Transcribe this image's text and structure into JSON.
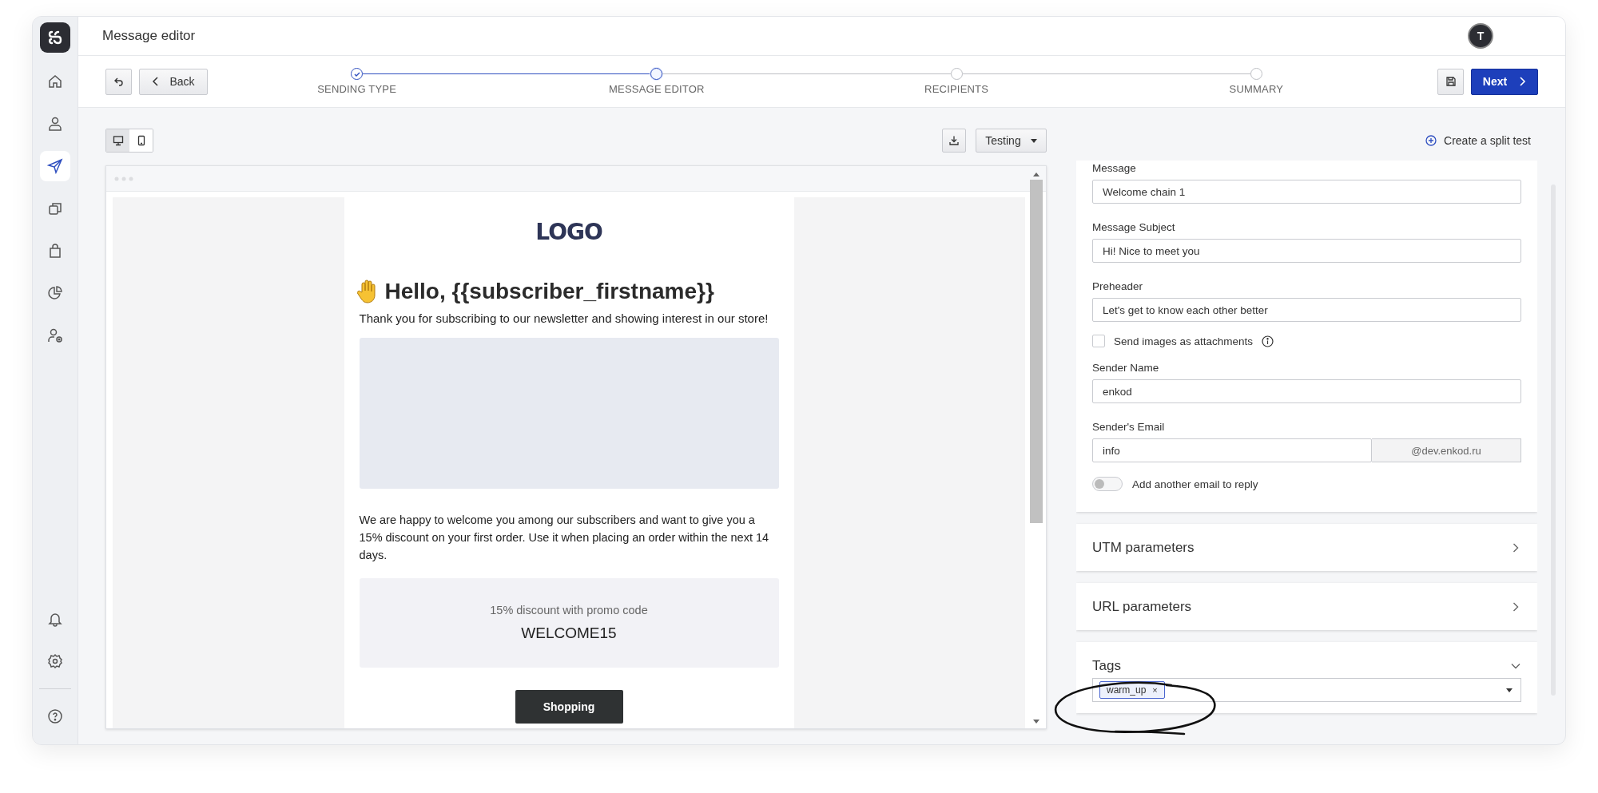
{
  "app_title": "Message editor",
  "user": {
    "initial": "T"
  },
  "sidebar": {
    "top_items": [
      {
        "kind": "home",
        "selected": false
      },
      {
        "kind": "user",
        "selected": false
      },
      {
        "kind": "send",
        "selected": true
      },
      {
        "kind": "copy",
        "selected": false
      },
      {
        "kind": "bag",
        "selected": false
      },
      {
        "kind": "pie",
        "selected": false
      },
      {
        "kind": "user-settings",
        "selected": false
      }
    ],
    "bottom_items": [
      {
        "kind": "bell",
        "selected": false
      },
      {
        "kind": "gear",
        "selected": false
      },
      {
        "kind": "help",
        "selected": false
      }
    ]
  },
  "back_label": "Back",
  "steps": [
    {
      "label": "SENDING TYPE",
      "done": true,
      "selected": false
    },
    {
      "label": "MESSAGE EDITOR",
      "done": false,
      "selected": true
    },
    {
      "label": "RECIPIENTS",
      "done": false,
      "selected": false
    },
    {
      "label": "SUMMARY",
      "done": false,
      "selected": false
    }
  ],
  "next_label": "Next",
  "view_modes": [
    {
      "kind": "desktop",
      "selected": true
    },
    {
      "kind": "mobile",
      "selected": false
    }
  ],
  "testing_label": "Testing",
  "split_test_label": "Create a split test",
  "email": {
    "logo": "LOGO",
    "heading": "Hello, {{subscriber_firstname}}",
    "intro": "Thank you for subscribing to our newsletter and showing interest in our store!",
    "body": "We are happy to welcome you among our subscribers and want to give you a 15% discount on your first order. Use it when placing an order within the next 14 days.",
    "promo_caption": "15% discount with promo code",
    "promo_code": "WELCOME15",
    "button": "Shopping"
  },
  "form": [
    {
      "kind": "text",
      "label": "Message",
      "value": "Welcome chain 1"
    },
    {
      "kind": "text",
      "label": "Message Subject",
      "value": "Hi! Nice to meet you"
    },
    {
      "kind": "text",
      "label": "Preheader",
      "value": "Let's get to know each other better"
    },
    {
      "kind": "checkbox",
      "label": "Send images as attachments",
      "checked": false
    },
    {
      "kind": "text",
      "label": "Sender Name",
      "value": "enkod"
    },
    {
      "kind": "email",
      "label": "Sender's Email",
      "value": "info",
      "domain": "@dev.enkod.ru"
    },
    {
      "kind": "toggle",
      "label": "Add another email to reply",
      "on": false
    }
  ],
  "sections": [
    {
      "title": "UTM parameters",
      "expanded": false
    },
    {
      "title": "URL parameters",
      "expanded": false
    },
    {
      "title": "Tags",
      "expanded": true,
      "tags": [
        {
          "label": "warm_up",
          "remove": "×"
        }
      ]
    }
  ]
}
